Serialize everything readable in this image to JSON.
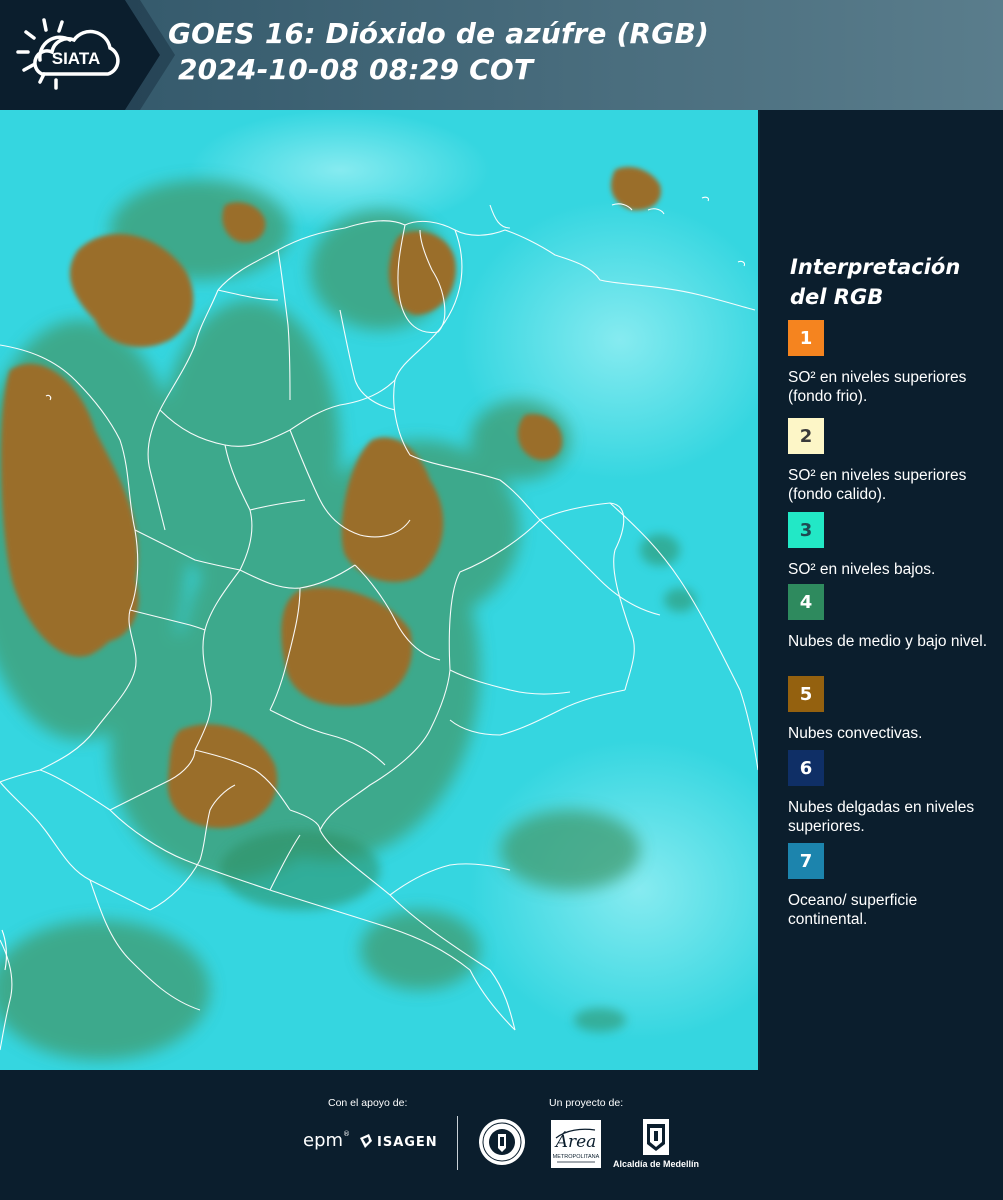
{
  "header": {
    "logo_text": "SIATA",
    "title_line1": "GOES 16: Dióxido de azúfre (RGB)",
    "title_line2": "2024-10-08 08:29 COT"
  },
  "legend": {
    "title_line1": "Interpretación",
    "title_line2": "del RGB",
    "items": [
      {
        "number": "1",
        "color": "#f5841f",
        "text_color": "#ffffff",
        "text": "SO² en niveles superiores (fondo frio)."
      },
      {
        "number": "2",
        "color": "#fdf6c7",
        "text_color": "#3a3a3a",
        "text": "SO² en niveles superiores (fondo calido)."
      },
      {
        "number": "3",
        "color": "#22e8c6",
        "text_color": "#1e4a52",
        "text": "SO² en niveles bajos."
      },
      {
        "number": "4",
        "color": "#2e8a5e",
        "text_color": "#ffffff",
        "text": "Nubes de medio y bajo nivel."
      },
      {
        "number": "5",
        "color": "#94610f",
        "text_color": "#ffffff",
        "text": "Nubes convectivas."
      },
      {
        "number": "6",
        "color": "#0f2f66",
        "text_color": "#ffffff",
        "text": "Nubes delgadas en niveles superiores."
      },
      {
        "number": "7",
        "color": "#1c84ad",
        "text_color": "#ffffff",
        "text": "Oceano/ superficie continental."
      }
    ]
  },
  "footer": {
    "support_label": "Con el apoyo de:",
    "project_label": "Un proyecto de:",
    "epm": "epm",
    "isagen": "ISAGEN",
    "metropolitana_caption": "METROPOLITANA",
    "area_text": "Área",
    "alcaldia_caption": "Alcaldía de Medellín"
  },
  "colors": {
    "background": "#0b1e2d",
    "header_band": "#4e7080",
    "ocean_cyan": "#33d8e2",
    "convective_brown": "#9a6f2c",
    "midlevel_green": "#3e9a72"
  }
}
